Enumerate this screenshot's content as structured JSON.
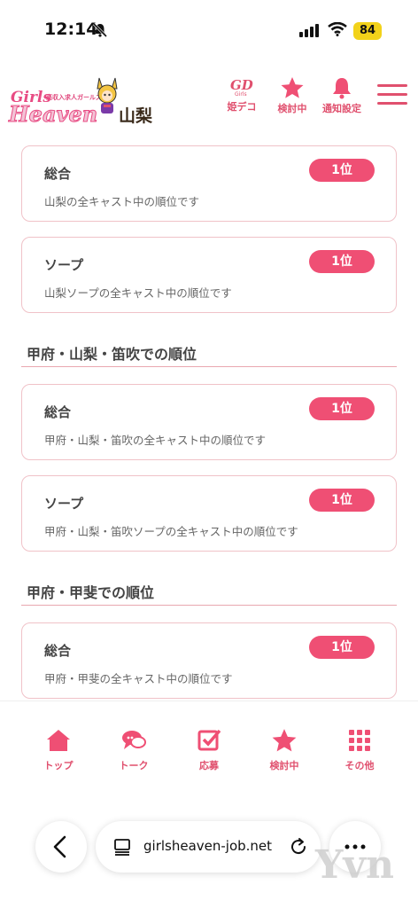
{
  "status_bar": {
    "time": "12:14",
    "battery": "84"
  },
  "header": {
    "logo": {
      "small_text": "高収入求人ガールズ",
      "girls": "Girls",
      "heaven": "Heaven",
      "region": "山梨"
    },
    "buttons": [
      {
        "label": "姫デコ",
        "icon": "himedeco-icon"
      },
      {
        "label": "検討中",
        "icon": "star-icon"
      },
      {
        "label": "通知設定",
        "icon": "bell-icon"
      }
    ],
    "menu_icon": "hamburger-menu-icon"
  },
  "content": {
    "cards_top": [
      {
        "title": "総合",
        "rank": "1位",
        "desc": "山梨の全キャスト中の順位です"
      },
      {
        "title": "ソープ",
        "rank": "1位",
        "desc": "山梨ソープの全キャスト中の順位です"
      }
    ],
    "section1": {
      "title": "甲府・山梨・笛吹での順位",
      "cards": [
        {
          "title": "総合",
          "rank": "1位",
          "desc": "甲府・山梨・笛吹の全キャスト中の順位です"
        },
        {
          "title": "ソープ",
          "rank": "1位",
          "desc": "甲府・山梨・笛吹ソープの全キャスト中の順位です"
        }
      ]
    },
    "section2": {
      "title": "甲府・甲斐での順位",
      "cards": [
        {
          "title": "総合",
          "rank": "1位",
          "desc": "甲府・甲斐の全キャスト中の順位です"
        }
      ]
    }
  },
  "bottom_nav": [
    {
      "label": "トップ",
      "icon": "home-icon"
    },
    {
      "label": "トーク",
      "icon": "chat-icon"
    },
    {
      "label": "応募",
      "icon": "apply-check-icon"
    },
    {
      "label": "検討中",
      "icon": "star-icon"
    },
    {
      "label": "その他",
      "icon": "grid-icon"
    }
  ],
  "browser": {
    "url": "girlsheaven-job.net",
    "watermark": "Yvn"
  },
  "colors": {
    "accent": "#ef4f74",
    "card_border": "#f0c2c8",
    "section_line": "#e9a8b0"
  }
}
